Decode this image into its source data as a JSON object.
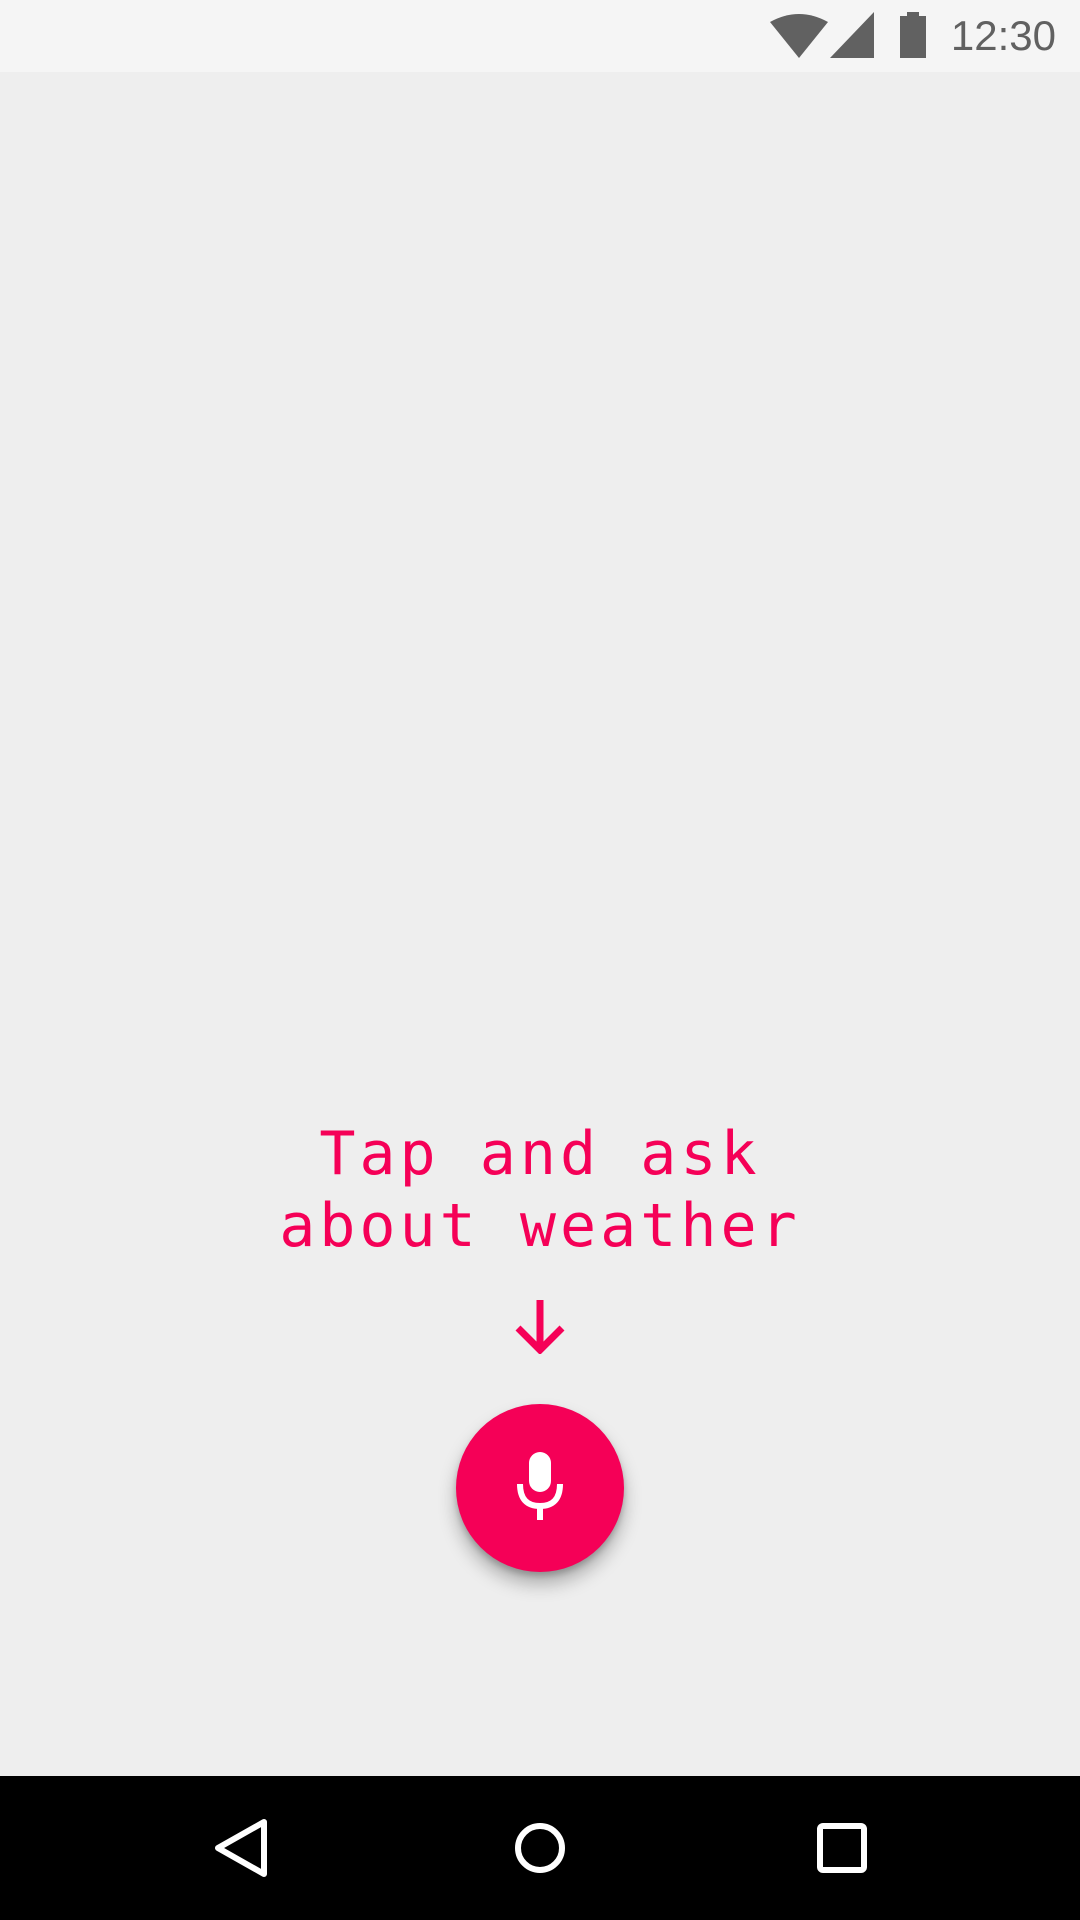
{
  "status_bar": {
    "time": "12:30",
    "icons": [
      "wifi-icon",
      "cell-signal-icon",
      "battery-icon"
    ]
  },
  "prompt": {
    "line1": "Tap and ask",
    "line2": "about weather"
  },
  "hint_arrow_icon": "arrow-down-icon",
  "mic_button": {
    "icon": "microphone-icon"
  },
  "nav_bar": {
    "buttons": [
      "back-icon",
      "home-icon",
      "recents-icon"
    ]
  },
  "colors": {
    "accent": "#f50057",
    "background": "#eeeeee",
    "status_bar": "#f5f5f5",
    "status_icons": "#616161",
    "nav_bar": "#000000"
  }
}
